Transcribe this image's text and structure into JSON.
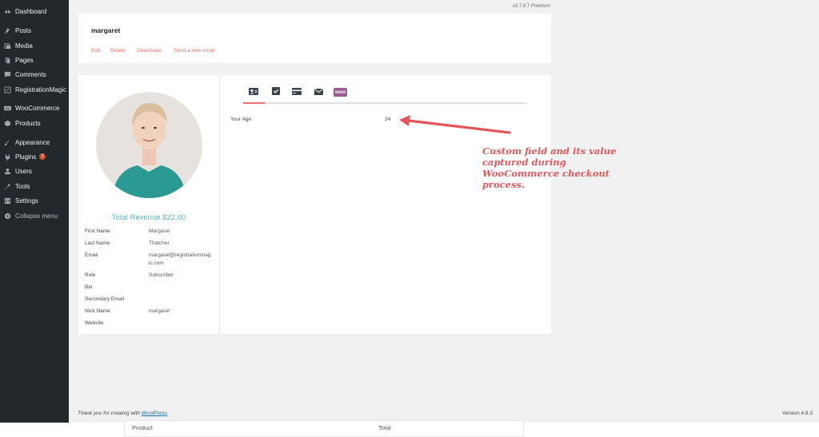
{
  "sidebar": {
    "items": [
      {
        "label": "Dashboard",
        "icon": "dashboard-icon"
      },
      {
        "label": "Posts",
        "icon": "pushpin-icon"
      },
      {
        "label": "Media",
        "icon": "media-icon"
      },
      {
        "label": "Pages",
        "icon": "pages-icon"
      },
      {
        "label": "Comments",
        "icon": "comment-icon"
      },
      {
        "label": "RegistrationMagic",
        "icon": "registrationmagic-icon"
      },
      {
        "label": "WooCommerce",
        "icon": "woocommerce-icon"
      },
      {
        "label": "Products",
        "icon": "products-icon"
      },
      {
        "label": "Appearance",
        "icon": "brush-icon"
      },
      {
        "label": "Plugins",
        "icon": "plugin-icon",
        "badge": "2"
      },
      {
        "label": "Users",
        "icon": "user-icon"
      },
      {
        "label": "Tools",
        "icon": "wrench-icon"
      },
      {
        "label": "Settings",
        "icon": "settings-icon"
      },
      {
        "label": "Collapse menu",
        "icon": "collapse-icon"
      }
    ]
  },
  "header": {
    "version": "v3.7.9.7 Premium",
    "user_name": "margaret",
    "actions": [
      "Edit",
      "Delete",
      "Deactivate",
      "Send a new email"
    ]
  },
  "profile": {
    "revenue": "Total Revenue $22.00",
    "fields": [
      {
        "label": "First Name",
        "value": "Margaret"
      },
      {
        "label": "Last Name",
        "value": "Thatcher"
      },
      {
        "label": "Email",
        "value": "margaret@registrationmag ic.com"
      },
      {
        "label": "Role",
        "value": "Subscriber"
      },
      {
        "label": "Bio",
        "value": ""
      },
      {
        "label": "Secondary Email",
        "value": ""
      },
      {
        "label": "Nick Name",
        "value": "margaret"
      },
      {
        "label": "Website",
        "value": ""
      }
    ]
  },
  "tabs": [
    {
      "name": "profile-card-icon"
    },
    {
      "name": "checkbox-icon"
    },
    {
      "name": "credit-card-icon"
    },
    {
      "name": "envelope-icon"
    },
    {
      "name": "woo-icon",
      "label": "woo"
    }
  ],
  "custom_field": {
    "label": "Your Age",
    "value": "24"
  },
  "annotation": "Custom field and its value captured during WooCommerce checkout process.",
  "footer": {
    "thanks_prefix": "Thank you for creating with ",
    "wp_link": "WordPress",
    "thanks_suffix": ".",
    "version": "Version 4.8.3"
  },
  "bottom_table": {
    "headers": [
      "Product",
      "Total"
    ]
  },
  "colors": {
    "accent": "#e8706e",
    "sidebar": "#23282d",
    "revenue": "#57b8c0",
    "annotation": "#e2575a",
    "woo": "#9b5c8f"
  }
}
